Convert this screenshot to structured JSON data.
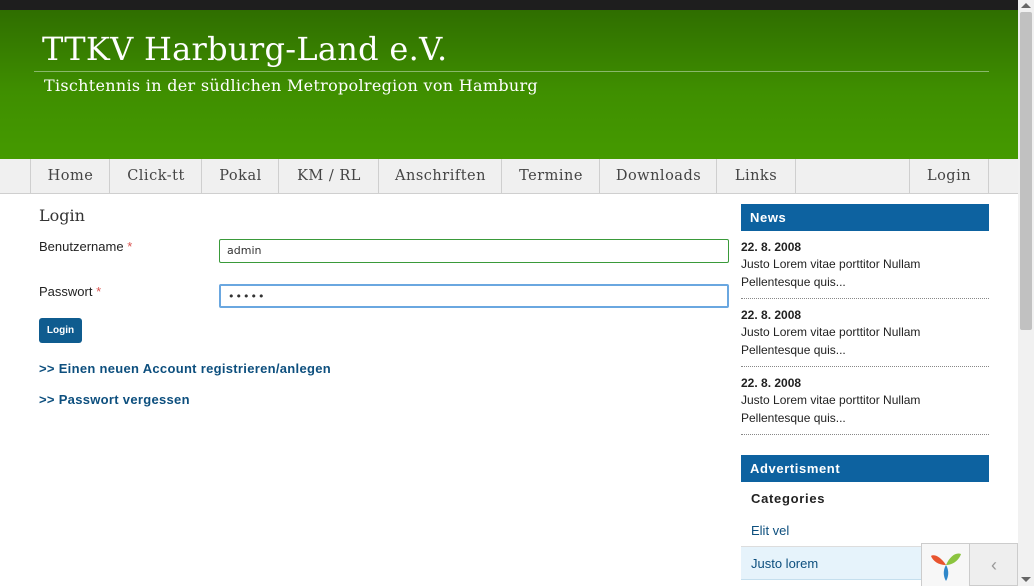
{
  "header": {
    "title": "TTKV Harburg-Land e.V.",
    "subtitle": "Tischtennis in der südlichen Metropolregion von Hamburg"
  },
  "nav": {
    "items": [
      "Home",
      "Click-tt",
      "Pokal",
      "KM / RL",
      "Anschriften",
      "Termine",
      "Downloads",
      "Links"
    ],
    "login": "Login"
  },
  "main": {
    "title": "Login",
    "username_label": "Benutzername",
    "username_value": "admin",
    "password_label": "Passwort",
    "password_value": "•••••",
    "required_mark": "*",
    "login_button": "Login",
    "register_link": ">> Einen neuen Account registrieren/anlegen",
    "forgot_link": ">> Passwort vergessen"
  },
  "sidebar": {
    "news_title": "News",
    "news": [
      {
        "date": "22. 8. 2008",
        "text": "Justo Lorem vitae porttitor Nullam Pellentesque quis..."
      },
      {
        "date": "22. 8. 2008",
        "text": "Justo Lorem vitae porttitor Nullam Pellentesque quis..."
      },
      {
        "date": "22. 8. 2008",
        "text": "Justo Lorem vitae porttitor Nullam Pellentesque quis..."
      }
    ],
    "ad_title": "Advertisment",
    "categories_title": "Categories",
    "categories": [
      "Elit vel",
      "Justo lorem"
    ]
  },
  "widget": {
    "chevron": "‹"
  },
  "colors": {
    "header_green": "#3f8f00",
    "sidebar_blue": "#0d62a0",
    "link_blue": "#0d4f7e"
  }
}
